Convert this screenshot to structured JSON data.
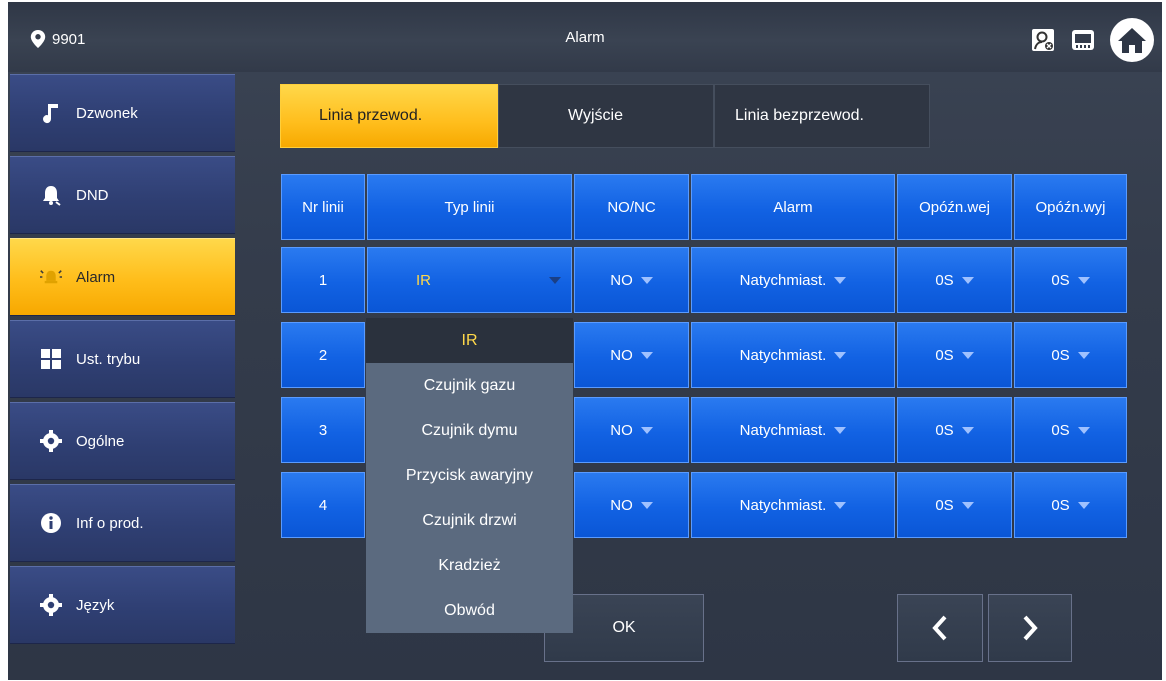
{
  "header": {
    "room_number": "9901",
    "title": "Alarm"
  },
  "sidebar": {
    "items": [
      {
        "label": "Dzwonek",
        "icon": "music-note-icon"
      },
      {
        "label": "DND",
        "icon": "bell-icon"
      },
      {
        "label": "Alarm",
        "icon": "alarm-icon",
        "active": true
      },
      {
        "label": "Ust. trybu",
        "icon": "grid-icon"
      },
      {
        "label": "Ogólne",
        "icon": "gear-icon"
      },
      {
        "label": "Inf o prod.",
        "icon": "info-icon"
      },
      {
        "label": "Język",
        "icon": "gear-icon"
      }
    ]
  },
  "tabs": [
    {
      "label": "Linia przewod.",
      "active": true
    },
    {
      "label": "Wyjście"
    },
    {
      "label": "Linia bezprzewod."
    }
  ],
  "table": {
    "headers": [
      "Nr linii",
      "Typ linii",
      "NO/NC",
      "Alarm",
      "Opóźn.wej",
      "Opóźn.wyj"
    ],
    "rows": [
      {
        "nr": "1",
        "type": "IR",
        "nonc": "NO",
        "alarm": "Natychmiast.",
        "delay_in": "0S",
        "delay_out": "0S"
      },
      {
        "nr": "2",
        "type": "",
        "nonc": "NO",
        "alarm": "Natychmiast.",
        "delay_in": "0S",
        "delay_out": "0S"
      },
      {
        "nr": "3",
        "type": "",
        "nonc": "NO",
        "alarm": "Natychmiast.",
        "delay_in": "0S",
        "delay_out": "0S"
      },
      {
        "nr": "4",
        "type": "",
        "nonc": "NO",
        "alarm": "Natychmiast.",
        "delay_in": "0S",
        "delay_out": "0S"
      }
    ]
  },
  "dropdown": {
    "options": [
      "IR",
      "Czujnik gazu",
      "Czujnik dymu",
      "Przycisk awaryjny",
      "Czujnik drzwi",
      "Kradzież",
      "Obwód"
    ],
    "selected": "IR"
  },
  "buttons": {
    "ok": "OK"
  },
  "colors": {
    "accent": "#ffbe1d",
    "cell_blue": "#1262e3",
    "sidebar_blue": "#2f3f73",
    "selected_text": "#ffd84a"
  }
}
